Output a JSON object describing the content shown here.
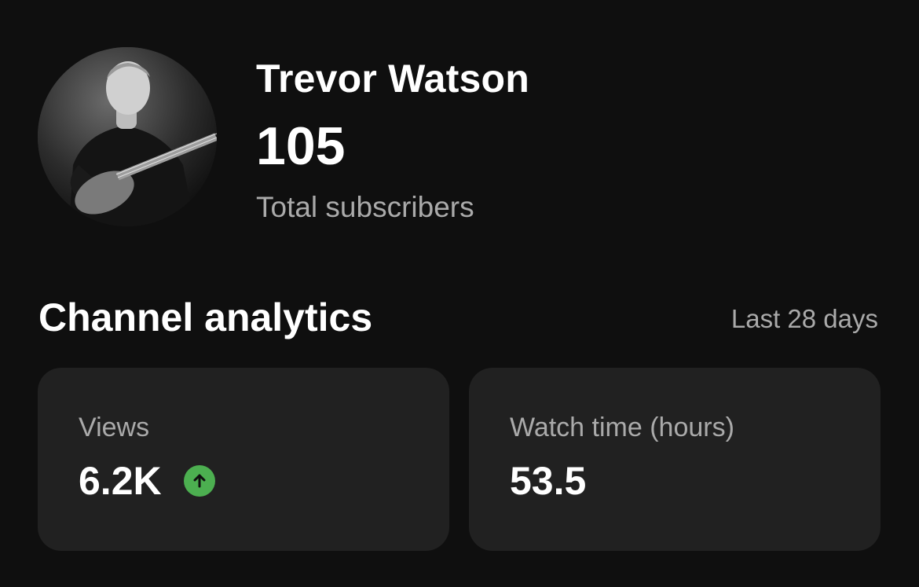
{
  "profile": {
    "name": "Trevor Watson",
    "subscriber_count": "105",
    "subscriber_label": "Total subscribers",
    "avatar_icon": "profile-photo"
  },
  "analytics": {
    "title": "Channel analytics",
    "period": "Last 28 days",
    "cards": [
      {
        "label": "Views",
        "value": "6.2K",
        "trend": "up",
        "trend_icon": "arrow-up-icon"
      },
      {
        "label": "Watch time (hours)",
        "value": "53.5"
      }
    ]
  },
  "colors": {
    "background": "#0f0f0f",
    "card": "#212121",
    "secondary_text": "#aaaaaa",
    "trend_up": "#4caf50"
  }
}
